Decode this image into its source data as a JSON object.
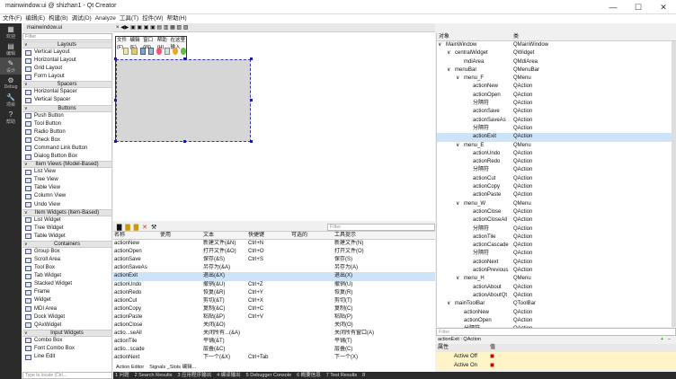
{
  "window": {
    "title": "mainwindow.ui @ shizhan1 - Qt Creator",
    "btn_min": "—",
    "btn_max": "☐",
    "btn_close": "✕"
  },
  "menubar": [
    "文件(F)",
    "编辑(E)",
    "构建(B)",
    "调试(D)",
    "Analyze",
    "工具(T)",
    "控件(W)",
    "帮助(H)"
  ],
  "modes": [
    {
      "icon": "▦",
      "label": "欢迎"
    },
    {
      "icon": "▤",
      "label": "编辑"
    },
    {
      "icon": "✎",
      "label": "设计"
    },
    {
      "icon": "⚙",
      "label": "Debug"
    },
    {
      "icon": "🔧",
      "label": "项目"
    },
    {
      "icon": "?",
      "label": "帮助"
    }
  ],
  "file_tab": "mainwindow.ui",
  "editor_tabs": "× ◀▶ ▣ ▣ ▣ ▣ ▤ ▥ ▦ ▧ ▨",
  "widgetbox": {
    "filter_placeholder": "Filter",
    "categories": [
      {
        "name": "Layouts",
        "items": [
          "Vertical Layout",
          "Horizontal Layout",
          "Grid Layout",
          "Form Layout"
        ]
      },
      {
        "name": "Spacers",
        "items": [
          "Horizontal Spacer",
          "Vertical Spacer"
        ]
      },
      {
        "name": "Buttons",
        "items": [
          "Push Button",
          "Tool Button",
          "Radio Button",
          "Check Box",
          "Command Link Button",
          "Dialog Button Box"
        ]
      },
      {
        "name": "Item Views (Model-Based)",
        "items": [
          "List View",
          "Tree View",
          "Table View",
          "Column View",
          "Undo View"
        ]
      },
      {
        "name": "Item Widgets (Item-Based)",
        "items": [
          "List Widget",
          "Tree Widget",
          "Table Widget"
        ]
      },
      {
        "name": "Containers",
        "items": [
          "Group Box",
          "Scroll Area",
          "Tool Box",
          "Tab Widget",
          "Stacked Widget",
          "Frame",
          "Widget",
          "MDI Area",
          "Dock Widget",
          "QAxWidget"
        ]
      },
      {
        "name": "Input Widgets",
        "items": [
          "Combo Box",
          "Font Combo Box",
          "Line Edit"
        ]
      }
    ],
    "locator": "Type to locate (Ctrl..."
  },
  "form": {
    "menus": [
      "文件(F)",
      "编辑(E)",
      "窗口(W)",
      "帮助(H)",
      "在这里输入"
    ]
  },
  "action_editor": {
    "filter_placeholder": "Filter",
    "headers": [
      "名称",
      "使用",
      "文本",
      "快捷键",
      "可选的",
      "工具提示"
    ],
    "rows": [
      {
        "name": "actionNew",
        "used": true,
        "text": "新建文件(&N)",
        "shortcut": "Ctrl+N",
        "checkable": false,
        "tip": "新建文件(N)"
      },
      {
        "name": "actionOpen",
        "used": true,
        "text": "打开文件(&O)",
        "shortcut": "Ctrl+O",
        "checkable": false,
        "tip": "打开文件(O)"
      },
      {
        "name": "actionSave",
        "used": true,
        "text": "保存(&S)",
        "shortcut": "Ctrl+S",
        "checkable": false,
        "tip": "保存(S)"
      },
      {
        "name": "actionSaveAs",
        "used": true,
        "text": "另存为(&A)",
        "shortcut": "",
        "checkable": false,
        "tip": "另存为(A)"
      },
      {
        "name": "actionExit",
        "used": true,
        "text": "退出(&X)",
        "shortcut": "",
        "checkable": false,
        "tip": "退出(X)"
      },
      {
        "name": "actionUndo",
        "used": true,
        "text": "撤销(&U)",
        "shortcut": "Ctrl+Z",
        "checkable": false,
        "tip": "撤销(U)"
      },
      {
        "name": "actionRedo",
        "used": true,
        "text": "恢复(&R)",
        "shortcut": "Ctrl+Y",
        "checkable": false,
        "tip": "恢复(R)"
      },
      {
        "name": "actionCut",
        "used": true,
        "text": "剪切(&T)",
        "shortcut": "Ctrl+X",
        "checkable": false,
        "tip": "剪切(T)"
      },
      {
        "name": "actionCopy",
        "used": true,
        "text": "复制(&C)",
        "shortcut": "Ctrl+C",
        "checkable": false,
        "tip": "复制(C)"
      },
      {
        "name": "actionPaste",
        "used": true,
        "text": "粘贴(&P)",
        "shortcut": "Ctrl+V",
        "checkable": false,
        "tip": "粘贴(P)"
      },
      {
        "name": "actionClose",
        "used": true,
        "text": "关闭(&O)",
        "shortcut": "",
        "checkable": false,
        "tip": "关闭(O)"
      },
      {
        "name": "actio...seAll",
        "used": true,
        "text": "关闭所有...(&A)",
        "shortcut": "",
        "checkable": false,
        "tip": "关闭所有窗口(A)"
      },
      {
        "name": "actionTile",
        "used": true,
        "text": "平铺(&T)",
        "shortcut": "",
        "checkable": false,
        "tip": "平铺(T)"
      },
      {
        "name": "actio...scade",
        "used": true,
        "text": "层叠(&C)",
        "shortcut": "",
        "checkable": false,
        "tip": "层叠(C)"
      },
      {
        "name": "actionNext",
        "used": true,
        "text": "下一个(&X)",
        "shortcut": "Ctrl+Tab",
        "checkable": false,
        "tip": "下一个(X)"
      }
    ],
    "bottom_tabs": [
      "Action Editor",
      "Signals _Slots 编辑..."
    ]
  },
  "output_tabs": [
    "1 问题",
    "2 Search Results",
    "3 应用程序输出",
    "4 编译输出",
    "5 Debugger Console",
    "6 概要信息",
    "7 Test Results",
    "8"
  ],
  "object_inspector": {
    "headers": [
      "对象",
      "类"
    ],
    "rows": [
      {
        "depth": 0,
        "arrow": "∨",
        "name": "MainWindow",
        "class": "QMainWindow"
      },
      {
        "depth": 1,
        "arrow": "∨",
        "name": "centralWidget",
        "class": "QWidget"
      },
      {
        "depth": 2,
        "arrow": "",
        "name": "mdiArea",
        "class": "QMdiArea"
      },
      {
        "depth": 1,
        "arrow": "∨",
        "name": "menuBar",
        "class": "QMenuBar"
      },
      {
        "depth": 2,
        "arrow": "∨",
        "name": "menu_F",
        "class": "QMenu"
      },
      {
        "depth": 3,
        "arrow": "",
        "name": "actionNew",
        "class": "QAction"
      },
      {
        "depth": 3,
        "arrow": "",
        "name": "actionOpen",
        "class": "QAction"
      },
      {
        "depth": 3,
        "arrow": "",
        "name": "分隔符",
        "class": "QAction"
      },
      {
        "depth": 3,
        "arrow": "",
        "name": "actionSave",
        "class": "QAction"
      },
      {
        "depth": 3,
        "arrow": "",
        "name": "actionSaveAs",
        "class": "QAction"
      },
      {
        "depth": 3,
        "arrow": "",
        "name": "分隔符",
        "class": "QAction"
      },
      {
        "depth": 3,
        "arrow": "",
        "name": "actionExit",
        "class": "QAction",
        "hl": true
      },
      {
        "depth": 2,
        "arrow": "∨",
        "name": "menu_E",
        "class": "QMenu"
      },
      {
        "depth": 3,
        "arrow": "",
        "name": "actionUndo",
        "class": "QAction"
      },
      {
        "depth": 3,
        "arrow": "",
        "name": "actionRedo",
        "class": "QAction"
      },
      {
        "depth": 3,
        "arrow": "",
        "name": "分隔符",
        "class": "QAction"
      },
      {
        "depth": 3,
        "arrow": "",
        "name": "actionCut",
        "class": "QAction"
      },
      {
        "depth": 3,
        "arrow": "",
        "name": "actionCopy",
        "class": "QAction"
      },
      {
        "depth": 3,
        "arrow": "",
        "name": "actionPaste",
        "class": "QAction"
      },
      {
        "depth": 2,
        "arrow": "∨",
        "name": "menu_W",
        "class": "QMenu"
      },
      {
        "depth": 3,
        "arrow": "",
        "name": "actionClose",
        "class": "QAction"
      },
      {
        "depth": 3,
        "arrow": "",
        "name": "actionCloseAll",
        "class": "QAction"
      },
      {
        "depth": 3,
        "arrow": "",
        "name": "分隔符",
        "class": "QAction"
      },
      {
        "depth": 3,
        "arrow": "",
        "name": "actionTile",
        "class": "QAction"
      },
      {
        "depth": 3,
        "arrow": "",
        "name": "actionCascade",
        "class": "QAction"
      },
      {
        "depth": 3,
        "arrow": "",
        "name": "分隔符",
        "class": "QAction"
      },
      {
        "depth": 3,
        "arrow": "",
        "name": "actionNext",
        "class": "QAction"
      },
      {
        "depth": 3,
        "arrow": "",
        "name": "actionPrevious",
        "class": "QAction"
      },
      {
        "depth": 2,
        "arrow": "∨",
        "name": "menu_H",
        "class": "QMenu"
      },
      {
        "depth": 3,
        "arrow": "",
        "name": "actionAbout",
        "class": "QAction"
      },
      {
        "depth": 3,
        "arrow": "",
        "name": "actionAboutQt",
        "class": "QAction"
      },
      {
        "depth": 1,
        "arrow": "∨",
        "name": "mainToolBar",
        "class": "QToolBar"
      },
      {
        "depth": 2,
        "arrow": "",
        "name": "actionNew",
        "class": "QAction"
      },
      {
        "depth": 2,
        "arrow": "",
        "name": "actionOpen",
        "class": "QAction"
      },
      {
        "depth": 2,
        "arrow": "",
        "name": "分隔符",
        "class": "QAction"
      }
    ]
  },
  "property_editor": {
    "filter_placeholder": "Filter",
    "context": "actionExit : QAction",
    "headers": [
      "属性",
      "值"
    ],
    "rows": [
      {
        "name": "Active Off",
        "value": ""
      },
      {
        "name": "Active On",
        "value": ""
      }
    ]
  },
  "colors": {
    "accent": "#cde3f7",
    "mode_bg": "#2b2b2b",
    "prop_bg": "#fff4c8"
  }
}
